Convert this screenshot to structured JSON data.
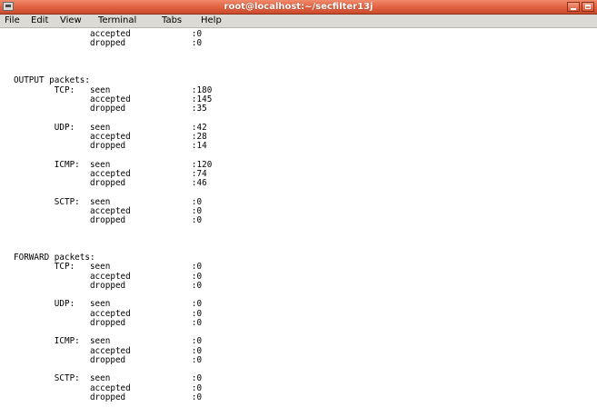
{
  "window": {
    "title": "root@localhost:~/secfilter13j"
  },
  "menubar": {
    "items": [
      "File",
      "Edit",
      "View",
      "Terminal",
      "Tabs",
      "Help"
    ]
  },
  "icons": {
    "window_menu": "terminal-window-icon",
    "minimize": "minimize-icon",
    "maximize": "maximize-icon"
  },
  "terminal": {
    "lines": [
      "               accepted            :0",
      "               dropped             :0",
      "",
      "",
      "",
      "OUTPUT packets:",
      "        TCP:   seen                :180",
      "               accepted            :145",
      "               dropped             :35",
      "",
      "        UDP:   seen                :42",
      "               accepted            :28",
      "               dropped             :14",
      "",
      "        ICMP:  seen                :120",
      "               accepted            :74",
      "               dropped             :46",
      "",
      "        SCTP:  seen                :0",
      "               accepted            :0",
      "               dropped             :0",
      "",
      "",
      "",
      "FORWARD packets:",
      "        TCP:   seen                :0",
      "               accepted            :0",
      "               dropped             :0",
      "",
      "        UDP:   seen                :0",
      "               accepted            :0",
      "               dropped             :0",
      "",
      "        ICMP:  seen                :0",
      "               accepted            :0",
      "               dropped             :0",
      "",
      "        SCTP:  seen                :0",
      "               accepted            :0",
      "               dropped             :0"
    ]
  }
}
